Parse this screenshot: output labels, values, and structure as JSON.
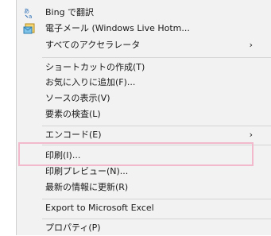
{
  "context_menu": {
    "items": [
      {
        "label": "Bing で翻訳",
        "icon": "bing-translate-icon"
      },
      {
        "label": "電子メール (Windows Live Hotm...",
        "icon": "email-blog-icon"
      },
      {
        "label": "すべてのアクセラレータ",
        "submenu": true
      },
      {
        "label": "ショートカットの作成(T)"
      },
      {
        "label": "お気に入りに追加(F)..."
      },
      {
        "label": "ソースの表示(V)"
      },
      {
        "label": "要素の検査(L)"
      },
      {
        "label": "エンコード(E)",
        "submenu": true
      },
      {
        "label": "印刷(I)...",
        "highlighted": true
      },
      {
        "label": "印刷プレビュー(N)..."
      },
      {
        "label": "最新の情報に更新(R)"
      },
      {
        "label": "Export to Microsoft Excel"
      },
      {
        "label": "プロパティ(P)"
      }
    ],
    "submenu_arrow": "›",
    "highlight_color": "#f2b8cc"
  }
}
